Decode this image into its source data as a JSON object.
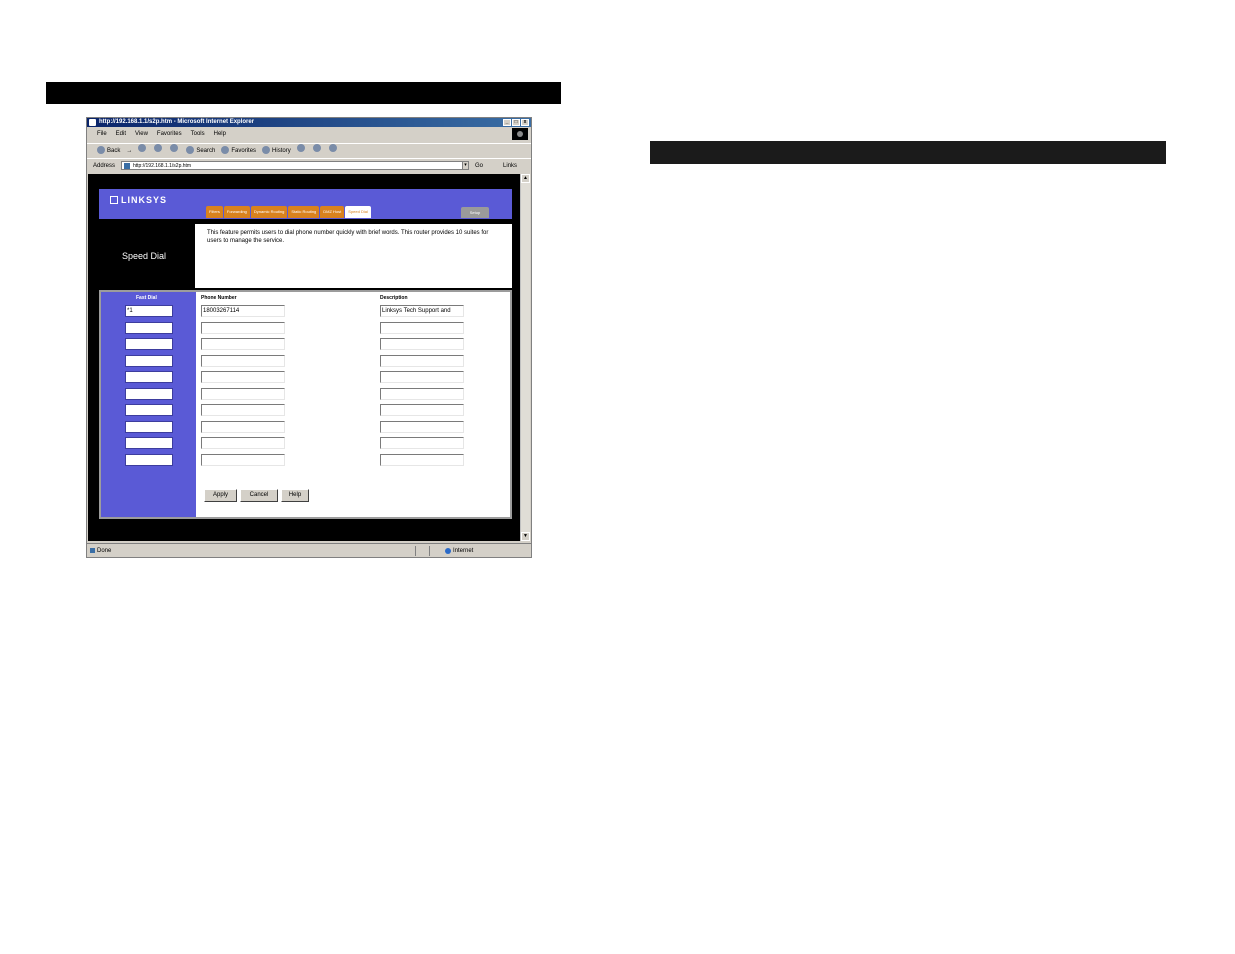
{
  "browser": {
    "title": "http://192.168.1.1/s2p.htm - Microsoft Internet Explorer",
    "window_buttons": [
      "_",
      "□",
      "x"
    ],
    "menu": [
      "File",
      "Edit",
      "View",
      "Favorites",
      "Tools",
      "Help"
    ],
    "toolbar": [
      "Back",
      "→",
      "Search",
      "Favorites",
      "History"
    ],
    "address_label": "Address",
    "address_value": "http://192.168.1.1/s2p.htm",
    "go_label": "Go",
    "links_label": "Links",
    "status_text": "Done",
    "zone_text": "Internet"
  },
  "page": {
    "logo": "LINKSYS",
    "tabs": [
      "Filters",
      "Forwarding",
      "Dynamic Routing",
      "Static Routing",
      "DMZ Host",
      "Speed Dial"
    ],
    "active_tab": "Speed Dial",
    "setup_tab": "Setup",
    "section_title": "Speed Dial",
    "description": "This feature permits users to dial phone number quickly with brief words. This router provides 10 suites for users to manage the service.",
    "columns": {
      "fast_dial": "Fast Dial",
      "phone_number": "Phone Number",
      "description": "Description"
    },
    "rows": [
      {
        "fast_dial": "*1",
        "phone": "18003267114",
        "desc": "Linksys Tech Support and"
      },
      {
        "fast_dial": "",
        "phone": "",
        "desc": ""
      },
      {
        "fast_dial": "",
        "phone": "",
        "desc": ""
      },
      {
        "fast_dial": "",
        "phone": "",
        "desc": ""
      },
      {
        "fast_dial": "",
        "phone": "",
        "desc": ""
      },
      {
        "fast_dial": "",
        "phone": "",
        "desc": ""
      },
      {
        "fast_dial": "",
        "phone": "",
        "desc": ""
      },
      {
        "fast_dial": "",
        "phone": "",
        "desc": ""
      },
      {
        "fast_dial": "",
        "phone": "",
        "desc": ""
      },
      {
        "fast_dial": "",
        "phone": "",
        "desc": ""
      }
    ],
    "buttons": {
      "apply": "Apply",
      "cancel": "Cancel",
      "help": "Help"
    }
  }
}
